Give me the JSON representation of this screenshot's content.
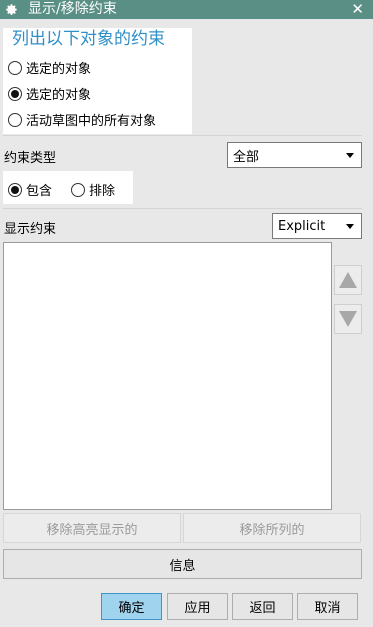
{
  "window": {
    "title": "显示/移除约束",
    "close_glyph": "✕"
  },
  "list_group": {
    "title": "列出以下对象的约束",
    "options": [
      {
        "label": "选定的对象",
        "checked": false
      },
      {
        "label": "选定的对象",
        "checked": true
      },
      {
        "label": "活动草图中的所有对象",
        "checked": false
      }
    ]
  },
  "constraint_type": {
    "label": "约束类型",
    "selected": "全部"
  },
  "filter": {
    "options": [
      {
        "label": "包含",
        "checked": true
      },
      {
        "label": "排除",
        "checked": false
      }
    ]
  },
  "display": {
    "label": "显示约束",
    "selected": "Explicit"
  },
  "buttons": {
    "remove_highlighted": "移除高亮显示的",
    "remove_listed": "移除所列的",
    "info": "信息",
    "ok": "确定",
    "apply": "应用",
    "back": "返回",
    "cancel": "取消"
  },
  "colors": {
    "titlebar": "#5a8f86",
    "group_title": "#2f8fc7",
    "primary_button": "#9fd3ee"
  }
}
